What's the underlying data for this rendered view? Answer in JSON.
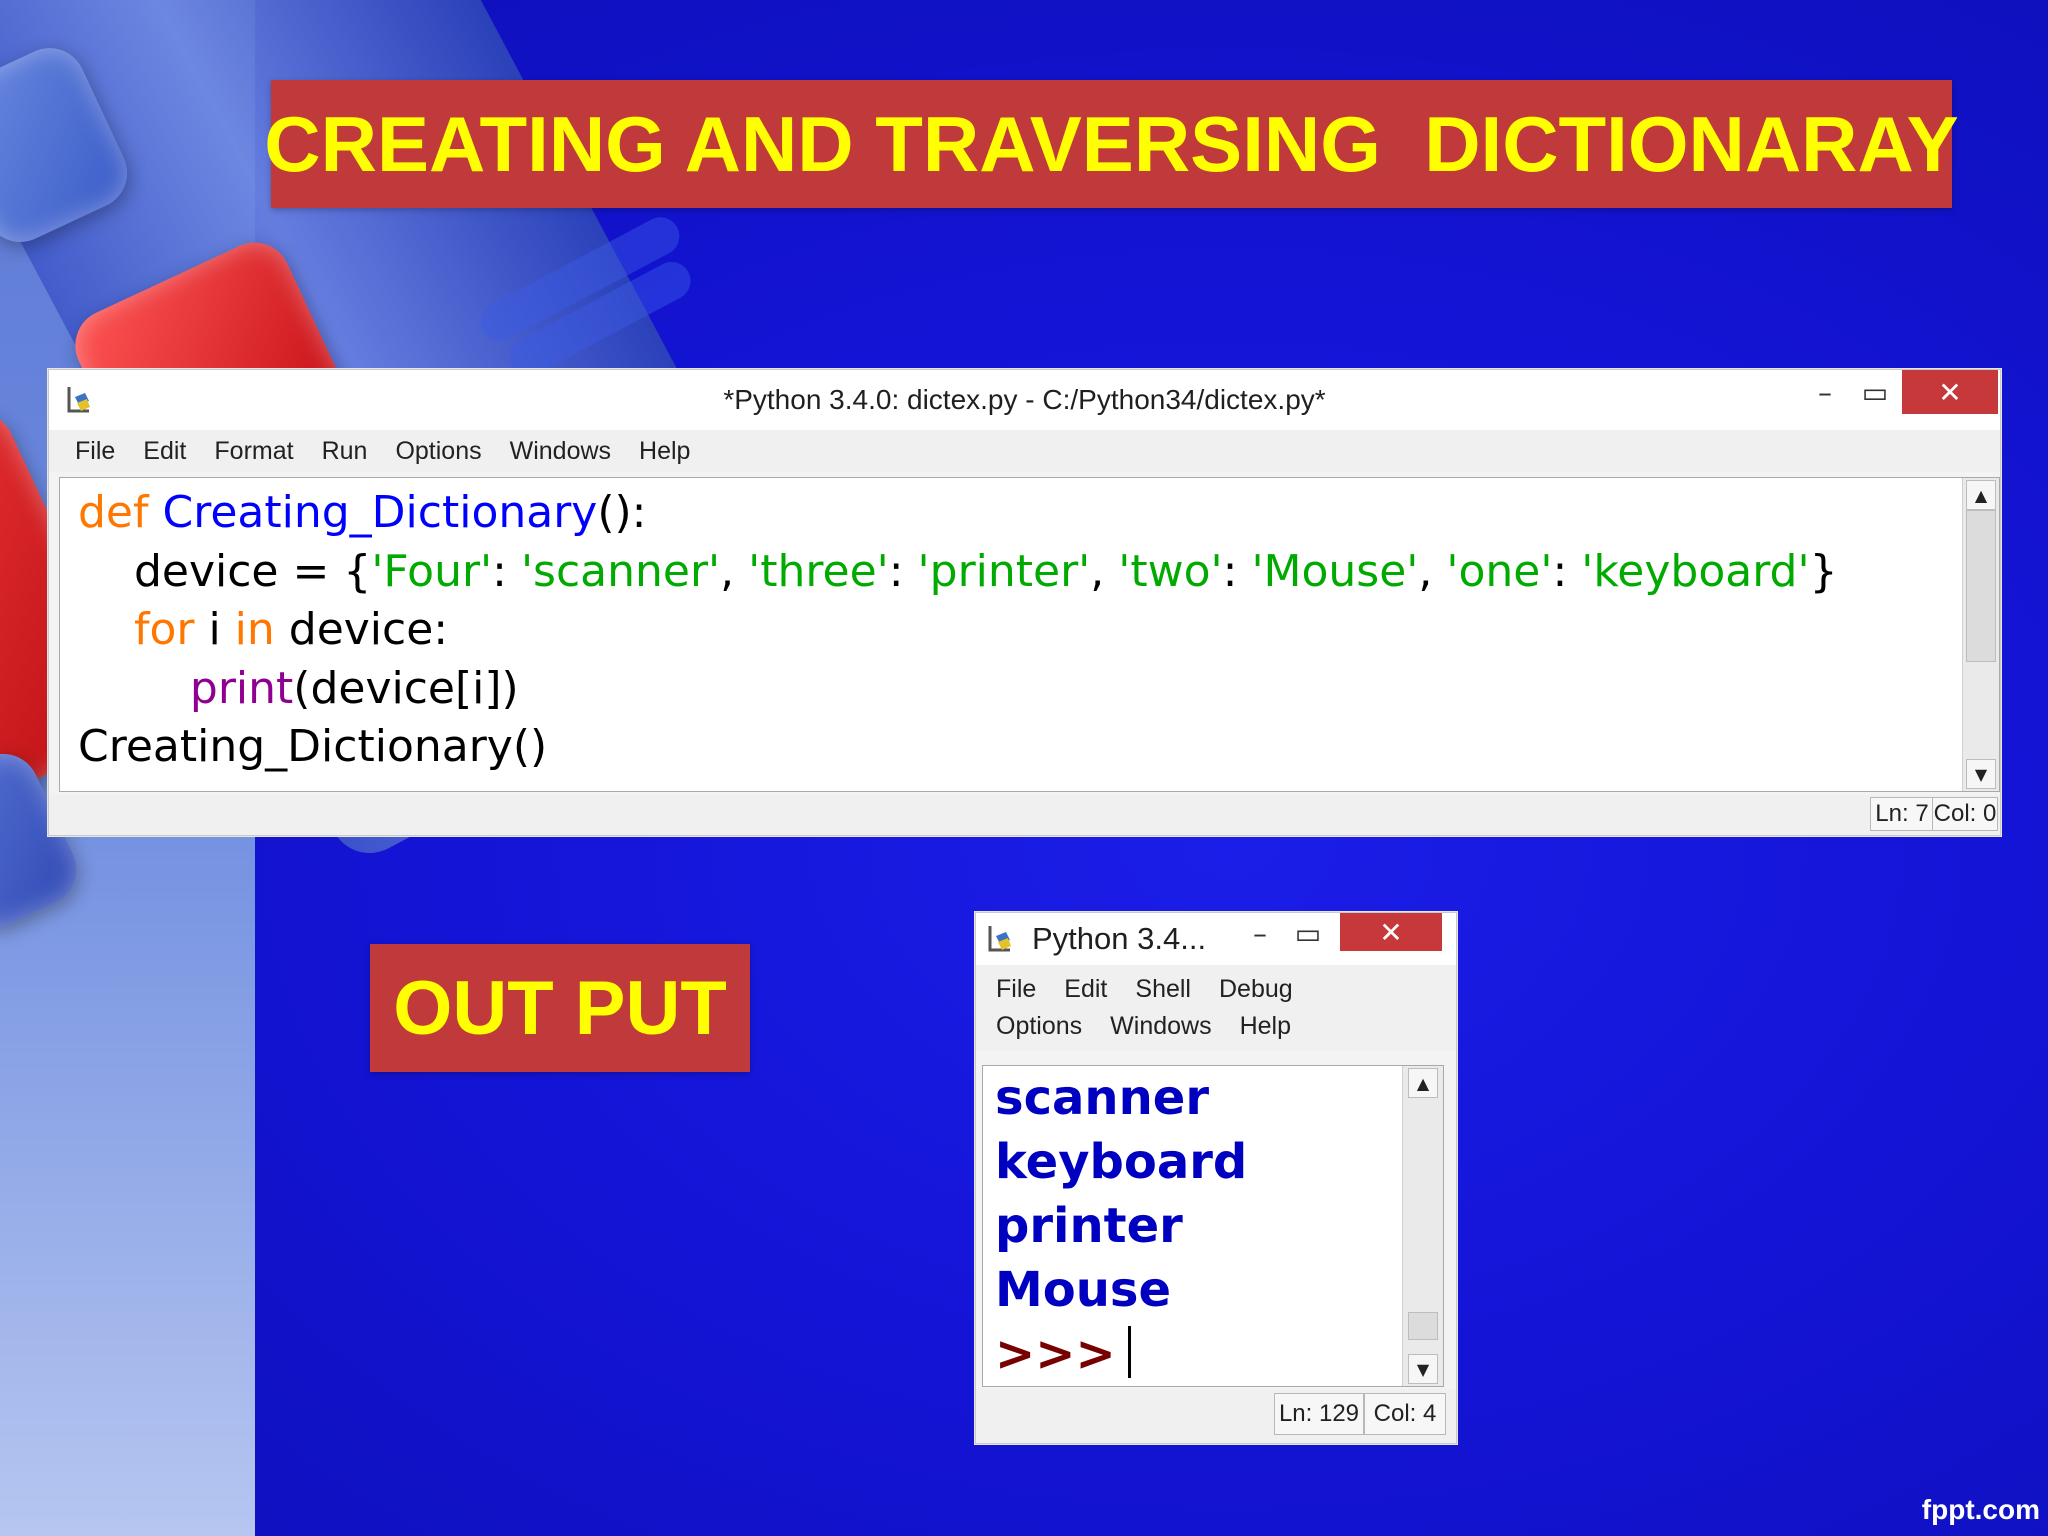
{
  "slide": {
    "title": "CREATING AND TRAVERSING  DICTIONARAY",
    "output_label": "OUT PUT",
    "watermark": "fppt.com"
  },
  "editor_window": {
    "title": "*Python 3.4.0: dictex.py - C:/Python34/dictex.py*",
    "menu": [
      "File",
      "Edit",
      "Format",
      "Run",
      "Options",
      "Windows",
      "Help"
    ],
    "controls": {
      "minimize": "–",
      "maximize": "▭",
      "close": "✕"
    },
    "code": {
      "l1_kw": "def",
      "l1_name": "Creating_Dictionary",
      "l1_rest": "():",
      "l2_a": "    device = {",
      "l2_s1": "'Four'",
      "l2_c1": ": ",
      "l2_s2": "'scanner'",
      "l2_c2": ", ",
      "l2_s3": "'three'",
      "l2_c3": ": ",
      "l2_s4": "'printer'",
      "l2_c4": ", ",
      "l2_s5": "'two'",
      "l2_c5": ": ",
      "l2_s6": "'Mouse'",
      "l2_c6": ", ",
      "l2_s7": "'one'",
      "l2_c7": ": ",
      "l2_s8": "'keyboard'",
      "l2_end": "}",
      "l3_indent": "    ",
      "l3_kw1": "for",
      "l3_mid": " i ",
      "l3_kw2": "in",
      "l3_rest": " device:",
      "l4_indent": "        ",
      "l4_builtin": "print",
      "l4_rest": "(device[i])",
      "l5": "Creating_Dictionary()"
    },
    "status": {
      "line": "Ln: 7",
      "col": "Col: 0"
    }
  },
  "shell_window": {
    "title": "Python 3.4...",
    "menu_row1": [
      "File",
      "Edit",
      "Shell",
      "Debug"
    ],
    "menu_row2": [
      "Options",
      "Windows",
      "Help"
    ],
    "controls": {
      "minimize": "–",
      "maximize": "▭",
      "close": "✕"
    },
    "output": [
      "scanner",
      "keyboard",
      "printer",
      "Mouse"
    ],
    "prompt": ">>>",
    "status": {
      "line": "Ln: 129",
      "col": "Col: 4"
    }
  },
  "icons": [
    "python-idle-icon",
    "minimize-icon",
    "maximize-icon",
    "close-icon",
    "scroll-up-icon",
    "scroll-down-icon"
  ]
}
